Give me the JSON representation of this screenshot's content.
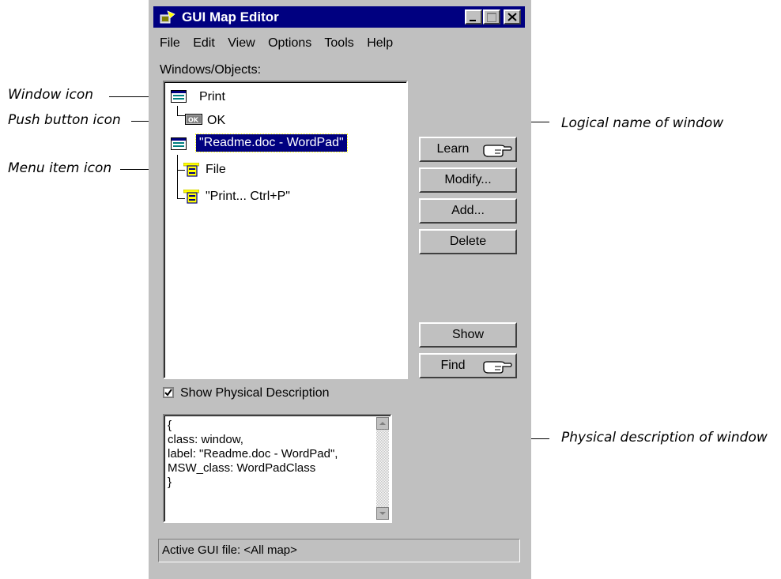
{
  "callouts": {
    "window_icon": "Window icon",
    "push_button_icon": "Push button icon",
    "menu_item_icon": "Menu item icon",
    "logical_name": "Logical name of window",
    "physical_description": "Physical description of window"
  },
  "window": {
    "title": "GUI Map Editor",
    "menu": [
      "File",
      "Edit",
      "View",
      "Options",
      "Tools",
      "Help"
    ],
    "objects_label": "Windows/Objects:",
    "tree": [
      {
        "label": "Print",
        "icon": "window-icon"
      },
      {
        "label": "OK",
        "icon": "push-button-icon"
      },
      {
        "label": "\"Readme.doc - WordPad\"",
        "icon": "window-icon",
        "selected": true
      },
      {
        "label": "File",
        "icon": "menu-item-icon"
      },
      {
        "label": "\"Print... Ctrl+P\"",
        "icon": "menu-item-icon"
      }
    ],
    "buttons": {
      "learn": "Learn",
      "modify": "Modify...",
      "add": "Add...",
      "delete": "Delete",
      "show": "Show",
      "find": "Find"
    },
    "show_physical_label": "Show Physical Description",
    "show_physical_checked": true,
    "physical_text": [
      "{",
      "class: window,",
      "label: \"Readme.doc - WordPad\",",
      "MSW_class: WordPadClass",
      "}"
    ],
    "status": "Active GUI file: <All map>"
  },
  "colors": {
    "titlebar": "#000080",
    "face": "#c0c0c0",
    "selection": "#000080"
  }
}
